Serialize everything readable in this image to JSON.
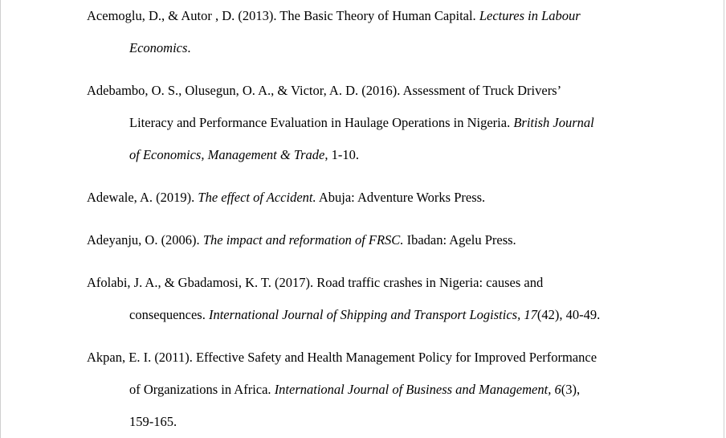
{
  "references": [
    {
      "lines": [
        [
          {
            "t": "Acemoglu, D., & Autor , D. (2013). The Basic Theory of Human Capital. "
          },
          {
            "t": "Lectures in Labour",
            "i": true
          }
        ],
        [
          {
            "t": "Economics",
            "i": true
          },
          {
            "t": "."
          }
        ]
      ]
    },
    {
      "lines": [
        [
          {
            "t": "Adebambo, O. S., Olusegun, O. A., & Victor, A. D. (2016). Assessment of Truck Drivers’"
          }
        ],
        [
          {
            "t": "Literacy and Performance Evaluation in Haulage Operations in Nigeria. "
          },
          {
            "t": "British Journal",
            "i": true
          }
        ],
        [
          {
            "t": "of Economics, Management & Trade",
            "i": true
          },
          {
            "t": ", 1-10."
          }
        ]
      ]
    },
    {
      "lines": [
        [
          {
            "t": "Adewale, A. (2019). "
          },
          {
            "t": "The effect of Accident.",
            "i": true
          },
          {
            "t": " Abuja: Adventure Works Press."
          }
        ]
      ]
    },
    {
      "lines": [
        [
          {
            "t": "Adeyanju, O. (2006). "
          },
          {
            "t": "The impact and reformation of FRSC.",
            "i": true
          },
          {
            "t": " Ibadan: Agelu Press."
          }
        ]
      ]
    },
    {
      "lines": [
        [
          {
            "t": "Afolabi, J. A., & Gbadamosi, K. T. (2017). Road traffic crashes in Nigeria: causes and"
          }
        ],
        [
          {
            "t": "consequences. "
          },
          {
            "t": "International Journal of Shipping and Transport Logistics, 17",
            "i": true
          },
          {
            "t": "(42), 40-49."
          }
        ]
      ]
    },
    {
      "lines": [
        [
          {
            "t": "Akpan, E. I. (2011). Effective Safety and Health Management Policy for Improved Performance"
          }
        ],
        [
          {
            "t": "of Organizations in Africa. "
          },
          {
            "t": "International Journal of Business and Management, 6",
            "i": true
          },
          {
            "t": "(3),"
          }
        ],
        [
          {
            "t": "159-165."
          }
        ]
      ]
    }
  ]
}
